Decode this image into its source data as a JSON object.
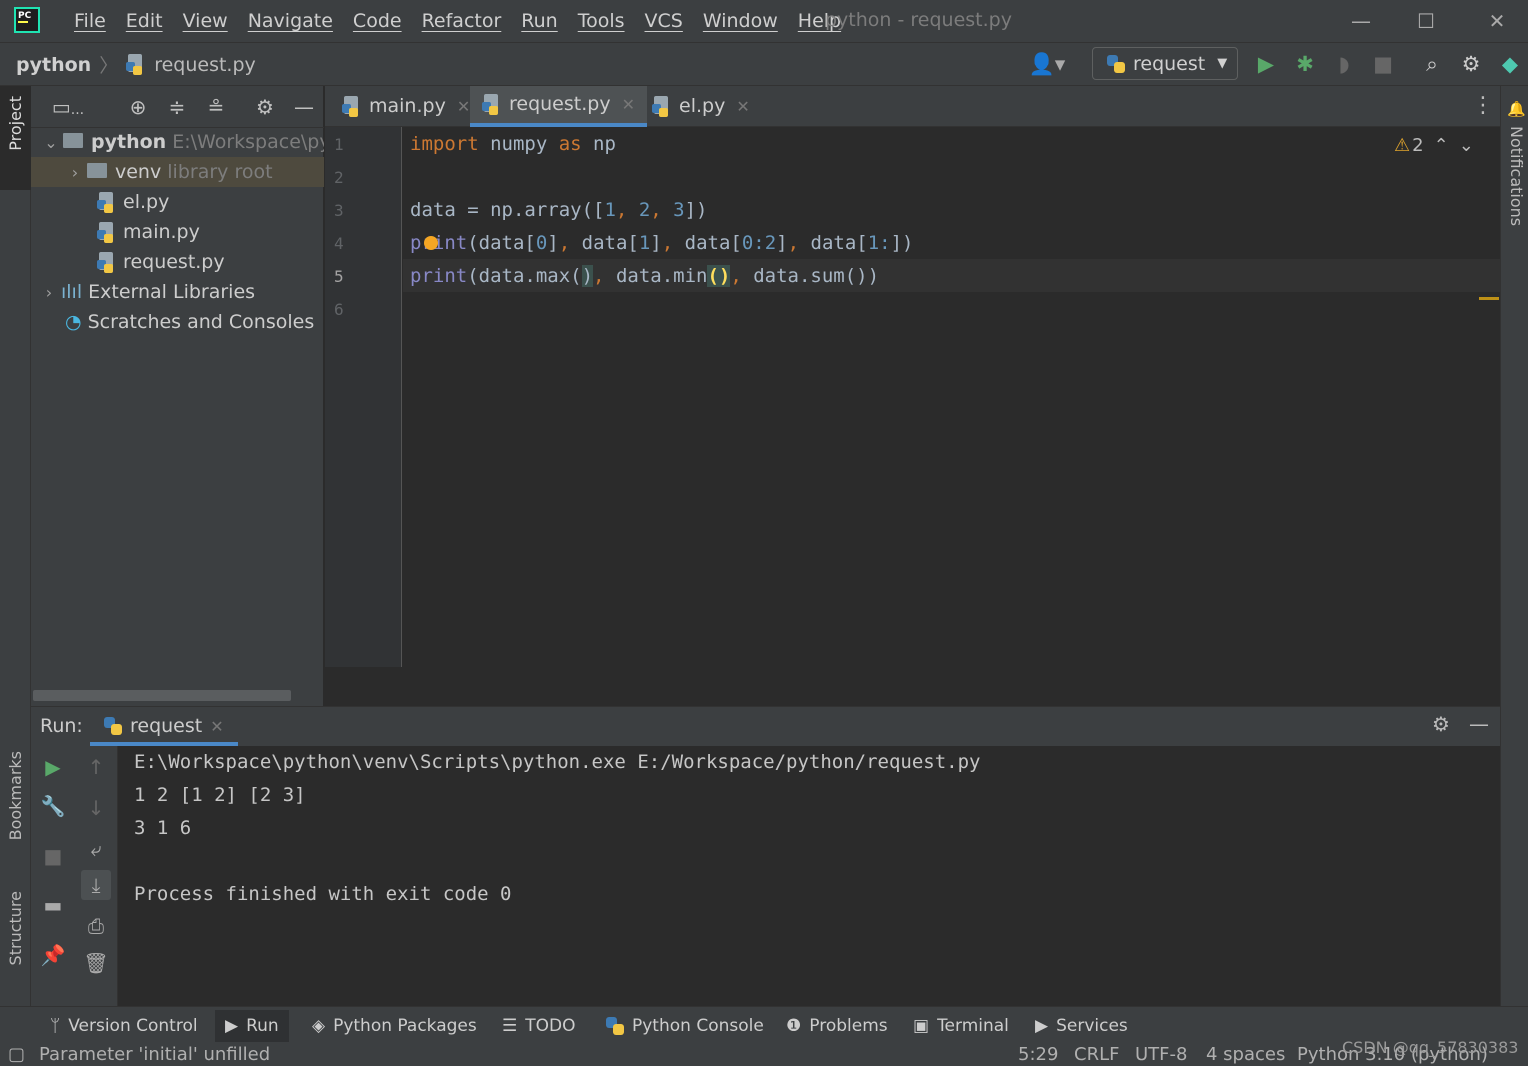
{
  "app": {
    "logo_text": "PC",
    "window_title": "python - request.py"
  },
  "menu": [
    "File",
    "Edit",
    "View",
    "Navigate",
    "Code",
    "Refactor",
    "Run",
    "Tools",
    "VCS",
    "Window",
    "Help"
  ],
  "breadcrumb": {
    "project": "python",
    "file": "request.py"
  },
  "toolbar": {
    "run_config": "request"
  },
  "sidebar_left": {
    "project_label": "Project",
    "bookmarks_label": "Bookmarks",
    "structure_label": "Structure"
  },
  "sidebar_right": {
    "notifications_label": "Notifications"
  },
  "project_panel": {
    "header_suffix": "...",
    "tree": [
      {
        "label": "python",
        "hint": "E:\\Workspace\\pyt"
      },
      {
        "label": "venv",
        "hint": "library root"
      },
      {
        "label": "el.py"
      },
      {
        "label": "main.py"
      },
      {
        "label": "request.py"
      },
      {
        "label": "External Libraries"
      },
      {
        "label": "Scratches and Consoles"
      }
    ]
  },
  "editor": {
    "tabs": [
      "main.py",
      "request.py",
      "el.py"
    ],
    "active_tab": "request.py",
    "line_numbers": [
      "1",
      "2",
      "3",
      "4",
      "5",
      "6"
    ],
    "current_line": "5",
    "warnings": "2",
    "code": {
      "l1": {
        "kw1": "import",
        "mod": " numpy ",
        "kw2": "as",
        "alias": " np"
      },
      "l3": {
        "a": "data = np.array([",
        "n1": "1",
        "c1": ", ",
        "n2": "2",
        "c2": ", ",
        "n3": "3",
        "b": "])"
      },
      "l4": {
        "fn": "print",
        "a": "(data[",
        "n0": "0",
        "b": "]",
        "c1": ", ",
        "d": "data[",
        "n1": "1",
        "e": "]",
        "c2": ", ",
        "f": "data[",
        "n2": "0:2",
        "g": "]",
        "c3": ", ",
        "h": "data[",
        "n3": "1:",
        "i": "])"
      },
      "l5": {
        "fn": "print",
        "a": "(data.max(",
        "p1": ")",
        "c1": ", ",
        "b": "data.min",
        "p2": "()",
        "c2": ", ",
        "c": "data.sum())"
      }
    }
  },
  "run_panel": {
    "label": "Run:",
    "tab": "request",
    "output": [
      "E:\\Workspace\\python\\venv\\Scripts\\python.exe E:/Workspace/python/request.py",
      "1 2 [1 2] [2 3]",
      "3 1 6",
      "",
      "Process finished with exit code 0"
    ]
  },
  "bottom_tabs": [
    "Version Control",
    "Run",
    "Python Packages",
    "TODO",
    "Python Console",
    "Problems",
    "Terminal",
    "Services"
  ],
  "active_bottom_tab": "Run",
  "status": {
    "message": "Parameter 'initial' unfilled",
    "position": "5:29",
    "line_sep": "CRLF",
    "encoding": "UTF-8",
    "indent": "4 spaces",
    "interpreter": "Python 3.10 (python)"
  },
  "watermark": "CSDN @qq_57830383"
}
